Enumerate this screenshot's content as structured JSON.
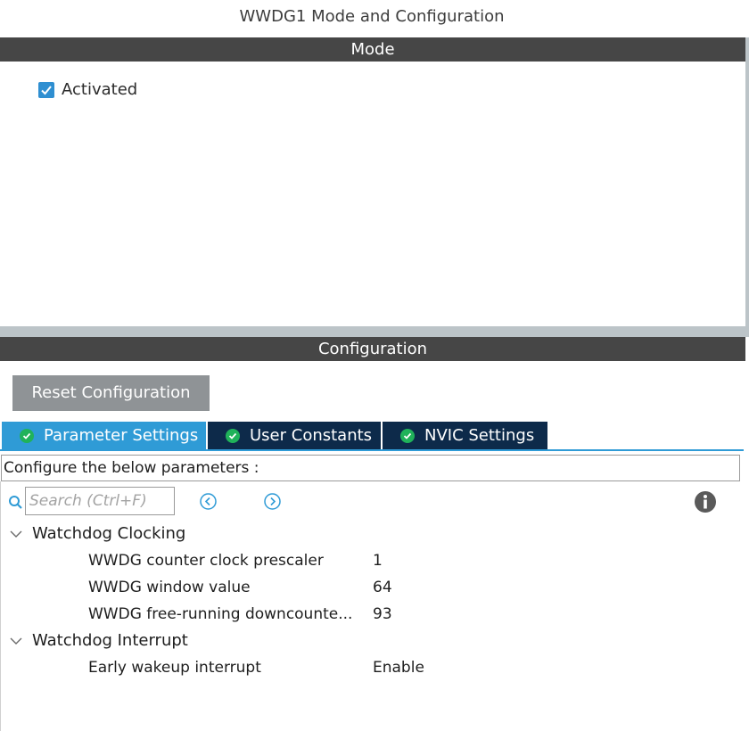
{
  "header": {
    "title": "WWDG1 Mode and Configuration"
  },
  "mode": {
    "section_label": "Mode",
    "activated": {
      "label": "Activated",
      "checked": true
    }
  },
  "configuration": {
    "section_label": "Configuration",
    "reset_button": "Reset Configuration",
    "tabs": [
      {
        "label": "Parameter Settings",
        "active": true,
        "icon": "check-circle-icon"
      },
      {
        "label": "User Constants",
        "active": false,
        "icon": "check-circle-icon"
      },
      {
        "label": "NVIC Settings",
        "active": false,
        "icon": "check-circle-icon"
      }
    ],
    "instructions": "Configure the below parameters :",
    "search": {
      "placeholder": "Search (Ctrl+F)",
      "value": ""
    },
    "groups": [
      {
        "name": "Watchdog Clocking",
        "expanded": true,
        "params": [
          {
            "label": "WWDG counter clock prescaler",
            "value": "1"
          },
          {
            "label": "WWDG window value",
            "value": "64"
          },
          {
            "label": "WWDG free-running downcounte...",
            "value": "93"
          }
        ]
      },
      {
        "name": "Watchdog Interrupt",
        "expanded": true,
        "params": [
          {
            "label": "Early wakeup interrupt",
            "value": "Enable"
          }
        ]
      }
    ]
  },
  "colors": {
    "section_bar": "#464646",
    "tab_active": "#2f9bd6",
    "tab_inactive": "#0d2a4a",
    "ok_badge": "#20b25a",
    "checkbox": "#2f8fd1",
    "reset_button": "#8f9396"
  }
}
